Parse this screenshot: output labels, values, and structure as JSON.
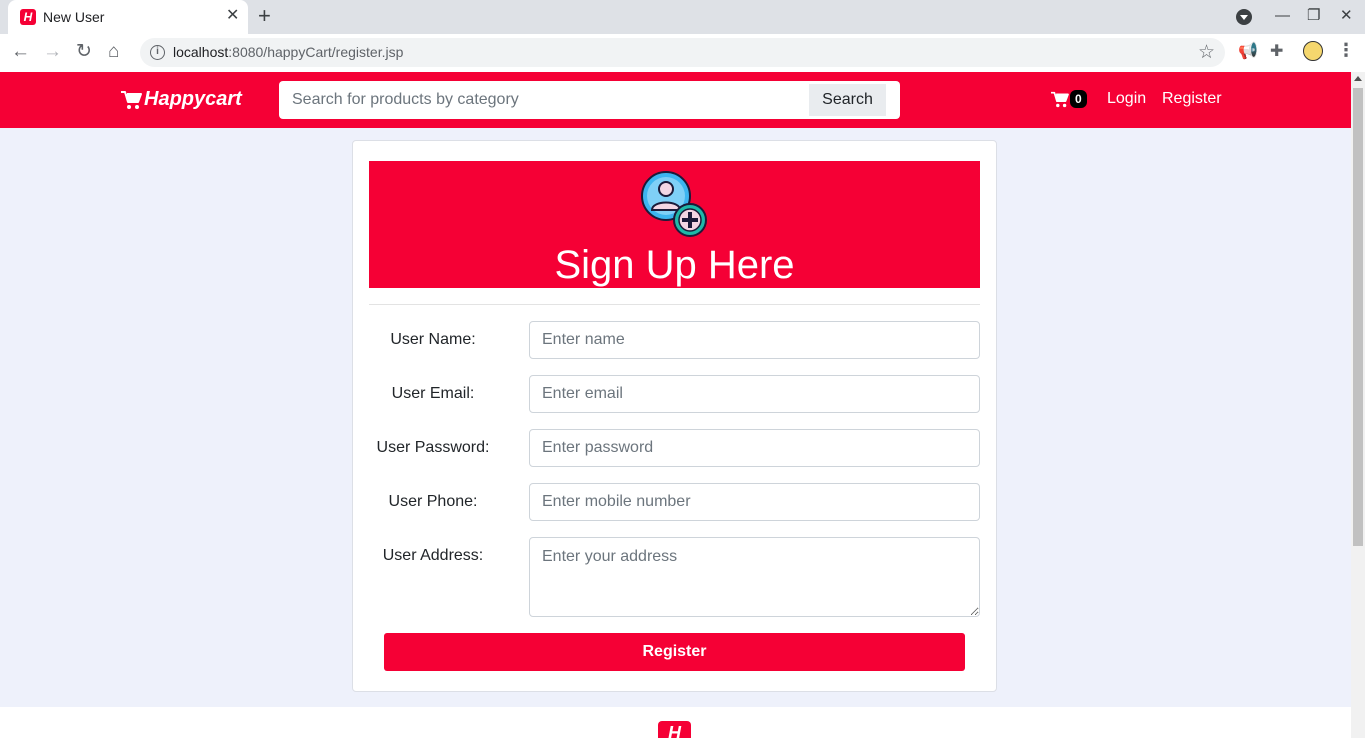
{
  "browser": {
    "tab_title": "New User",
    "tab_favicon_text": "H",
    "url_host": "localhost",
    "url_path": ":8080/happyCart/register.jsp",
    "icons": [
      "back-icon",
      "forward-icon",
      "reload-icon",
      "home-icon",
      "info-icon",
      "star-icon",
      "megaphone-icon",
      "puzzle-icon",
      "profile-avatar",
      "menu-dots-icon"
    ]
  },
  "nav": {
    "brand": "Happycart",
    "search_placeholder": "Search for products by category",
    "search_button": "Search",
    "cart_count": "0",
    "login": "Login",
    "register": "Register"
  },
  "form": {
    "title": "Sign Up Here",
    "fields": [
      {
        "label": "User Name:",
        "placeholder": "Enter name"
      },
      {
        "label": "User Email:",
        "placeholder": "Enter email"
      },
      {
        "label": "User Password:",
        "placeholder": "Enter password"
      },
      {
        "label": "User Phone:",
        "placeholder": "Enter mobile number"
      },
      {
        "label": "User Address:",
        "placeholder": "Enter your address"
      }
    ],
    "submit": "Register"
  },
  "footer": {
    "logo_text": "H"
  },
  "colors": {
    "brand": "#f50035",
    "page_bg": "#eef1fb"
  }
}
